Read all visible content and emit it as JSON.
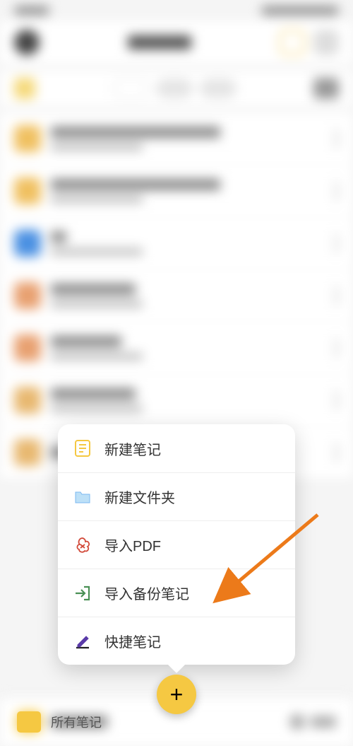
{
  "menu": {
    "items": [
      {
        "label": "新建笔记",
        "icon": "note-icon",
        "color": "#f5c842"
      },
      {
        "label": "新建文件夹",
        "icon": "folder-icon",
        "color": "#7bb8f0"
      },
      {
        "label": "导入PDF",
        "icon": "pdf-icon",
        "color": "#d24a3a"
      },
      {
        "label": "导入备份笔记",
        "icon": "import-icon",
        "color": "#4a9055"
      },
      {
        "label": "快捷笔记",
        "icon": "quicknote-icon",
        "color": "#5a3aa8"
      }
    ]
  },
  "fab": {
    "symbol": "+"
  },
  "bottomBar": {
    "label": "所有笔记"
  }
}
